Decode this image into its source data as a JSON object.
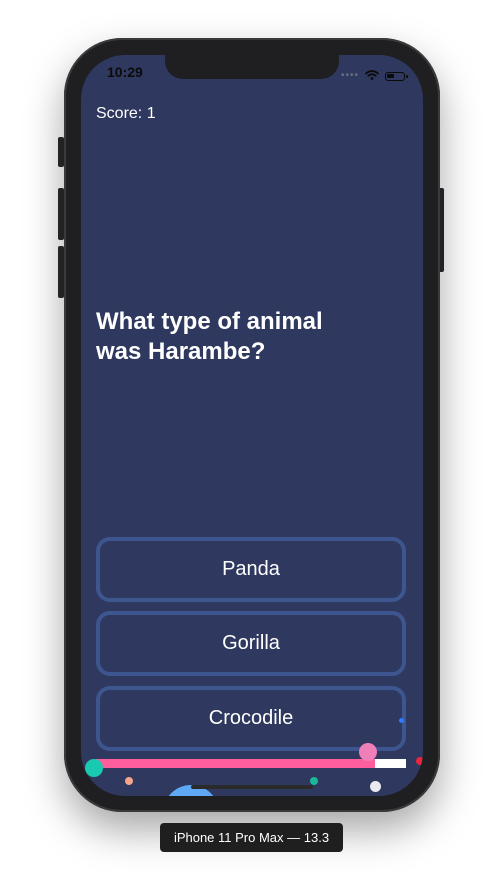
{
  "status_bar": {
    "time": "10:29",
    "signal_icon": "cellular-dots-icon",
    "wifi_icon": "wifi-icon",
    "battery_icon": "battery-icon"
  },
  "game": {
    "score_text": "Score: 1",
    "question": "What type of animal was Harambe?",
    "answers": [
      {
        "label": "Panda"
      },
      {
        "label": "Gorilla"
      },
      {
        "label": "Crocodile"
      }
    ],
    "timer_progress_fraction": 0.9
  },
  "device_label": "iPhone 11 Pro Max — 13.3",
  "colors": {
    "screen_background": "#2f385e",
    "answer_border": "#3e5690",
    "progress_fill": "#ff5e9c",
    "progress_track": "#ffffff",
    "text": "#ffffff"
  }
}
